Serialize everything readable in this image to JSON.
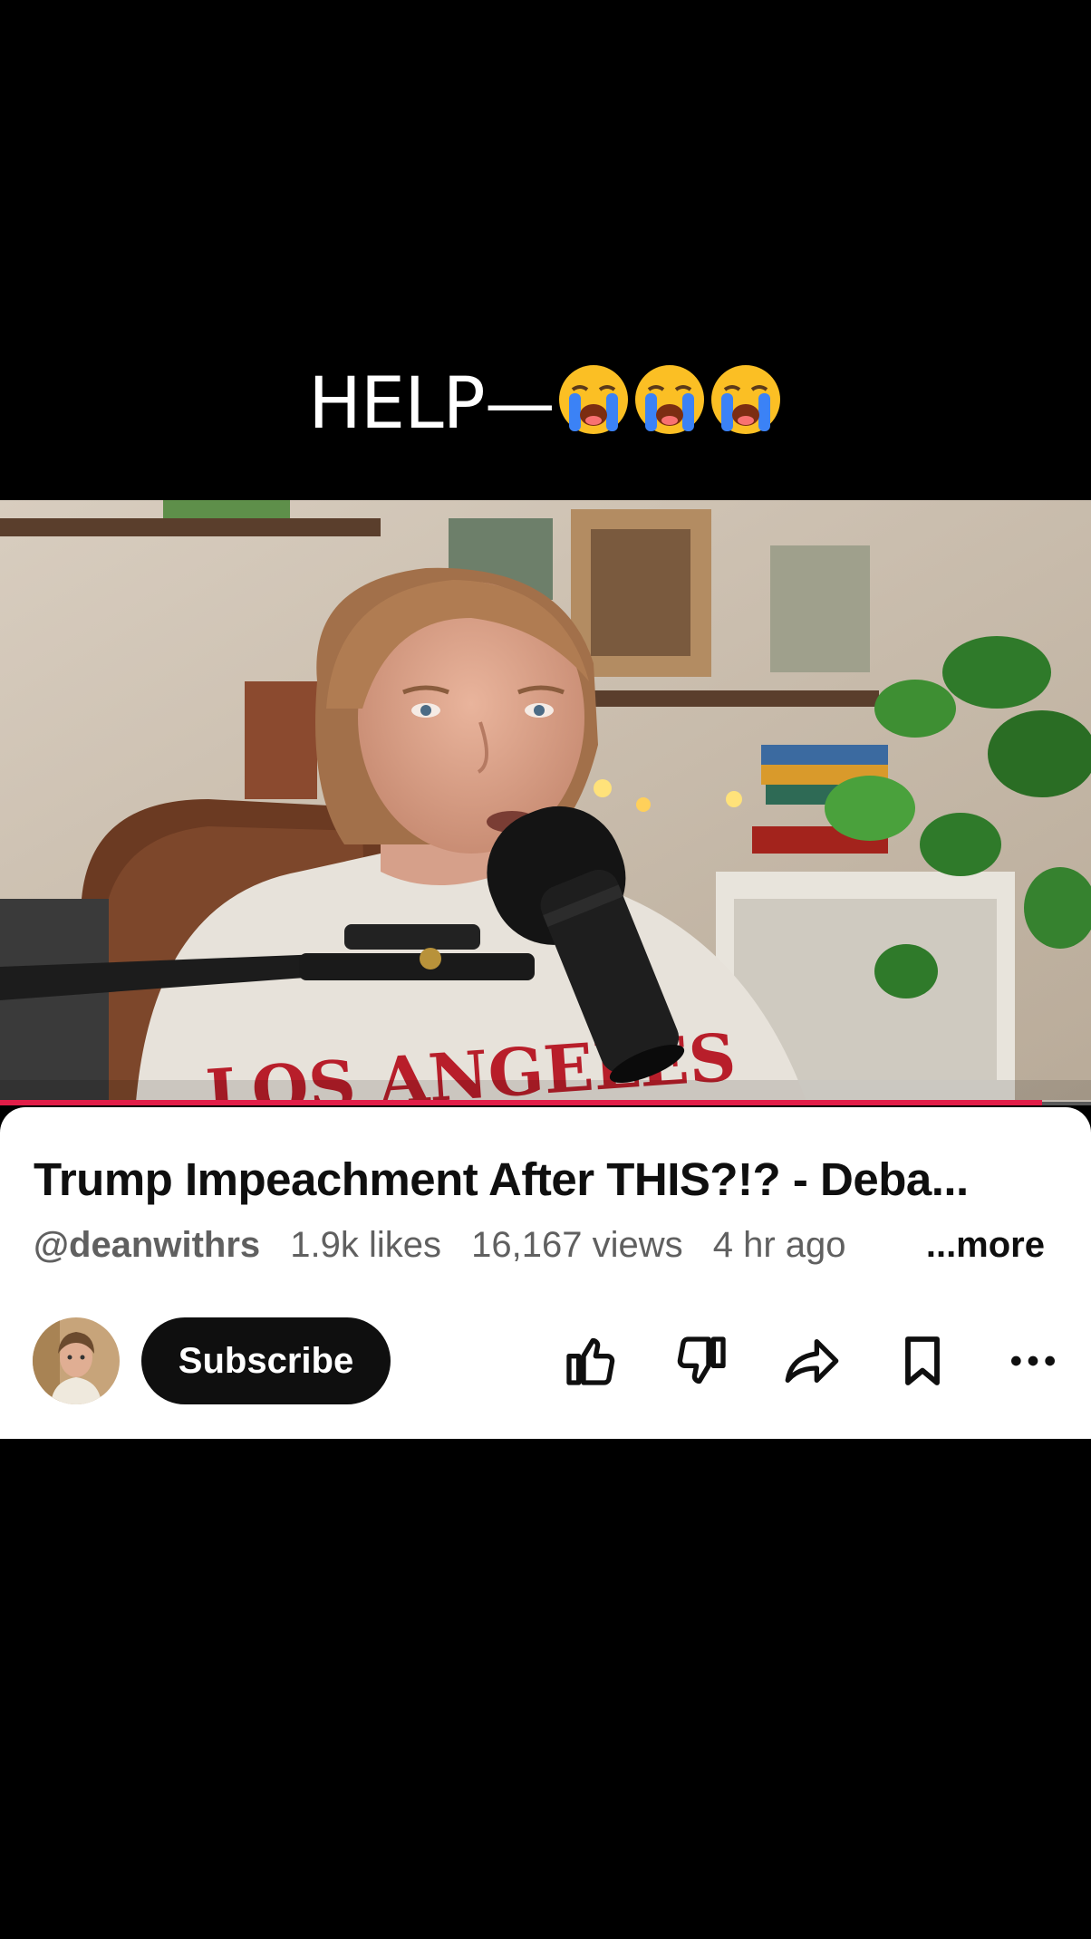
{
  "overlay": {
    "caption": "HELP—",
    "emoji": [
      "loudly-crying-face",
      "loudly-crying-face",
      "loudly-crying-face"
    ]
  },
  "player": {
    "progress_fraction": 0.955,
    "accent": "#e11d48",
    "shirt_text": "LOS ANGELES"
  },
  "video_info": {
    "title": "Trump Impeachment After THIS?!? - Deba...",
    "channel_handle": "@deanwithrs",
    "likes": "1.9k likes",
    "views": "16,167 views",
    "age": "4 hr ago",
    "more_label": "...more"
  },
  "actions": {
    "subscribe_label": "Subscribe",
    "icons": [
      "thumb-up-icon",
      "thumb-down-icon",
      "share-icon",
      "save-icon",
      "more-options-icon"
    ]
  }
}
